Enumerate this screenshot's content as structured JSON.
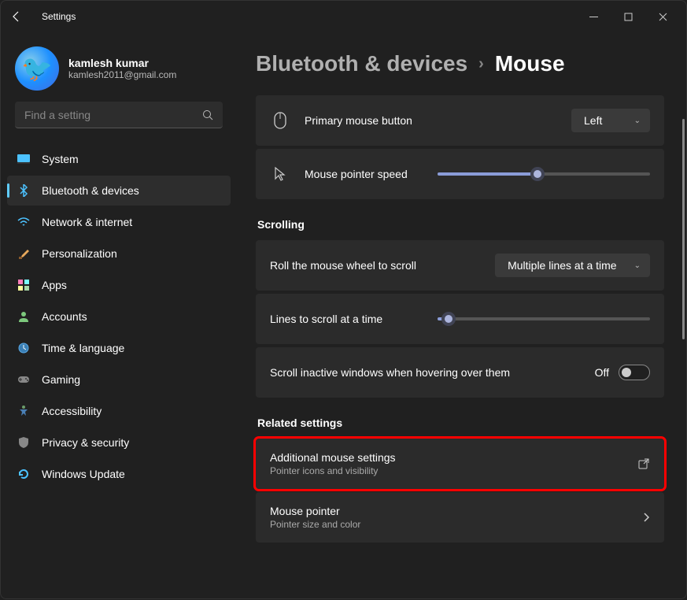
{
  "window": {
    "title": "Settings"
  },
  "user": {
    "name": "kamlesh kumar",
    "email": "kamlesh2011@gmail.com"
  },
  "search": {
    "placeholder": "Find a setting"
  },
  "nav": {
    "items": [
      {
        "label": "System"
      },
      {
        "label": "Bluetooth & devices"
      },
      {
        "label": "Network & internet"
      },
      {
        "label": "Personalization"
      },
      {
        "label": "Apps"
      },
      {
        "label": "Accounts"
      },
      {
        "label": "Time & language"
      },
      {
        "label": "Gaming"
      },
      {
        "label": "Accessibility"
      },
      {
        "label": "Privacy & security"
      },
      {
        "label": "Windows Update"
      }
    ]
  },
  "breadcrumb": {
    "parent": "Bluetooth & devices",
    "current": "Mouse"
  },
  "settings": {
    "primary_button": {
      "label": "Primary mouse button",
      "value": "Left"
    },
    "pointer_speed": {
      "label": "Mouse pointer speed",
      "percent": 47
    },
    "scrolling_header": "Scrolling",
    "wheel_scroll": {
      "label": "Roll the mouse wheel to scroll",
      "value": "Multiple lines at a time"
    },
    "lines_scroll": {
      "label": "Lines to scroll at a time",
      "percent": 5
    },
    "inactive_scroll": {
      "label": "Scroll inactive windows when hovering over them",
      "value": "Off"
    },
    "related_header": "Related settings",
    "additional": {
      "title": "Additional mouse settings",
      "subtitle": "Pointer icons and visibility"
    },
    "pointer": {
      "title": "Mouse pointer",
      "subtitle": "Pointer size and color"
    }
  }
}
